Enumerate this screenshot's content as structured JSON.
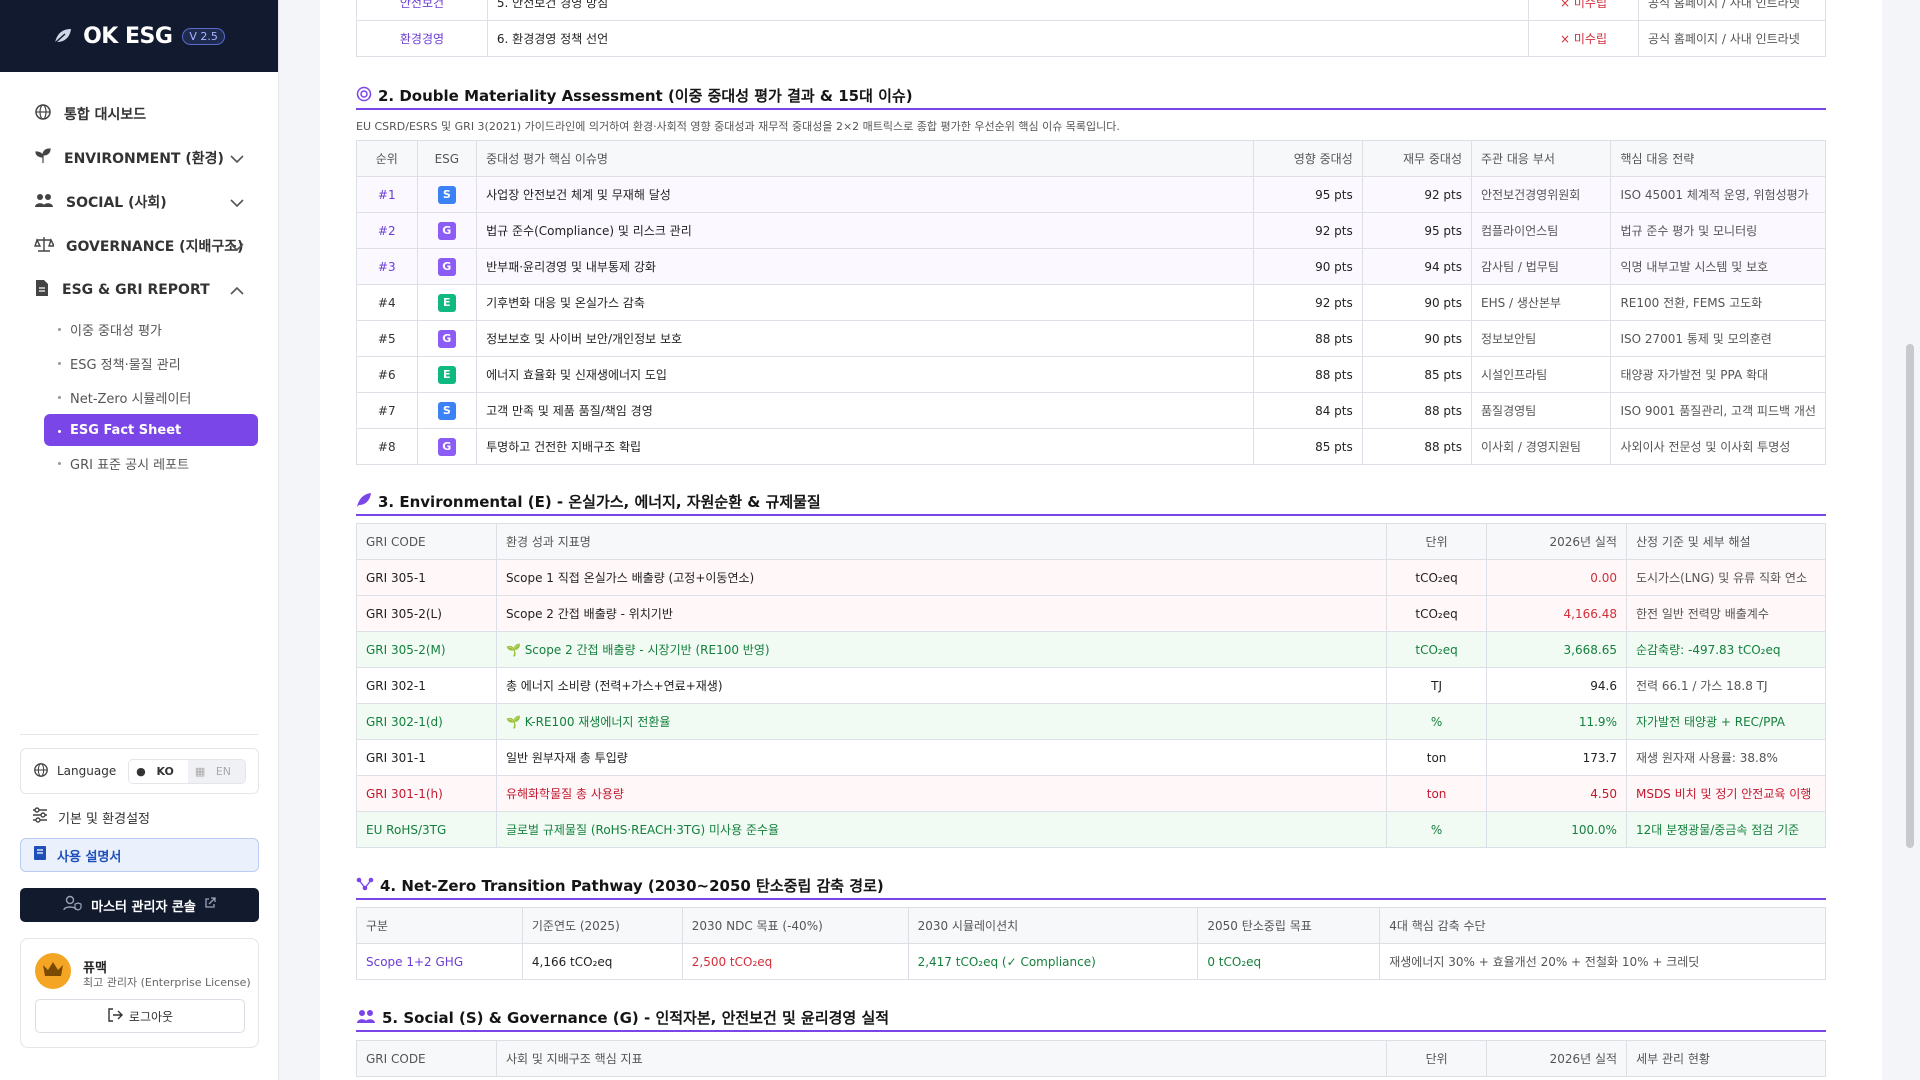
{
  "sidebar": {
    "logo_text": "OK ESG",
    "version": "V 2.5",
    "nav": [
      {
        "label": "통합 대시보드",
        "icon": "globe-icon"
      },
      {
        "label": "ENVIRONMENT (환경)",
        "icon": "leaf-icon"
      },
      {
        "label": "SOCIAL (사회)",
        "icon": "users-icon"
      },
      {
        "label": "GOVERNANCE (지배구조)",
        "icon": "scale-icon"
      },
      {
        "label": "ESG & GRI REPORT",
        "icon": "report-icon"
      }
    ],
    "sub": [
      "이중 중대성 평가",
      "ESG 정책·물질 관리",
      "Net-Zero 시뮬레이터",
      "ESG Fact Sheet",
      "GRI 표준 공시 레포트"
    ],
    "language_label": "Language",
    "lang_ko": "KO",
    "lang_en": "EN",
    "settings_label": "기본 및 환경설정",
    "manual_label": "사용 설명서",
    "console_label": "마스터 관리자 콘솔",
    "user_name": "퓨맥",
    "user_role": "최고 관리자 (Enterprise License)",
    "logout_label": "로그아웃"
  },
  "main": {
    "top_rows": [
      {
        "cat": "안전보건",
        "policy": "5. 안전보건 경영 방침",
        "status": "× 미수립",
        "channel": "공식 홈페이지 / 사내 인트라넷"
      },
      {
        "cat": "환경경영",
        "policy": "6. 환경경영 정책 선언",
        "status": "× 미수립",
        "channel": "공식 홈페이지 / 사내 인트라넷"
      }
    ],
    "s2": {
      "title": "2. Double Materiality Assessment (이중 중대성 평가 결과 & 15대 이슈)",
      "desc": "EU CSRD/ESRS 및 GRI 3(2021) 가이드라인에 의거하여 환경·사회적 영향 중대성과 재무적 중대성을 2×2 매트릭스로 종합 평가한 우선순위 핵심 이슈 목록입니다.",
      "headers": [
        "순위",
        "ESG",
        "중대성 평가 핵심 이슈명",
        "영향 중대성",
        "재무 중대성",
        "주관 대응 부서",
        "핵심 대응 전략"
      ],
      "rows": [
        {
          "rank": "#1",
          "esg": "S",
          "issue": "사업장 안전보건 체계 및 무재해 달성",
          "impact": "95 pts",
          "fin": "92 pts",
          "dept": "안전보건경영위원회",
          "strategy": "ISO 45001 체계적 운영, 위험성평가"
        },
        {
          "rank": "#2",
          "esg": "G",
          "issue": "법규 준수(Compliance) 및 리스크 관리",
          "impact": "92 pts",
          "fin": "95 pts",
          "dept": "컴플라이언스팀",
          "strategy": "법규 준수 평가 및 모니터링"
        },
        {
          "rank": "#3",
          "esg": "G",
          "issue": "반부패·윤리경영 및 내부통제 강화",
          "impact": "90 pts",
          "fin": "94 pts",
          "dept": "감사팀 / 법무팀",
          "strategy": "익명 내부고발 시스템 및 보호"
        },
        {
          "rank": "#4",
          "esg": "E",
          "issue": "기후변화 대응 및 온실가스 감축",
          "impact": "92 pts",
          "fin": "90 pts",
          "dept": "EHS / 생산본부",
          "strategy": "RE100 전환, FEMS 고도화"
        },
        {
          "rank": "#5",
          "esg": "G",
          "issue": "정보보호 및 사이버 보안/개인정보 보호",
          "impact": "88 pts",
          "fin": "90 pts",
          "dept": "정보보안팀",
          "strategy": "ISO 27001 통제 및 모의훈련"
        },
        {
          "rank": "#6",
          "esg": "E",
          "issue": "에너지 효율화 및 신재생에너지 도입",
          "impact": "88 pts",
          "fin": "85 pts",
          "dept": "시설인프라팀",
          "strategy": "태양광 자가발전 및 PPA 확대"
        },
        {
          "rank": "#7",
          "esg": "S",
          "issue": "고객 만족 및 제품 품질/책임 경영",
          "impact": "84 pts",
          "fin": "88 pts",
          "dept": "품질경영팀",
          "strategy": "ISO 9001 품질관리, 고객 피드백 개선"
        },
        {
          "rank": "#8",
          "esg": "G",
          "issue": "투명하고 건전한 지배구조 확립",
          "impact": "85 pts",
          "fin": "88 pts",
          "dept": "이사회 / 경영지원팀",
          "strategy": "사외이사 전문성 및 이사회 투명성"
        }
      ]
    },
    "s3": {
      "title": "3. Environmental (E) - 온실가스, 에너지, 자원순환 & 규제물질",
      "headers": [
        "GRI CODE",
        "환경 성과 지표명",
        "단위",
        "2026년 실적",
        "산정 기준 및 세부 해설"
      ],
      "rows": [
        {
          "code": "GRI 305-1",
          "name": "Scope 1 직접 온실가스 배출량 (고정+이동연소)",
          "unit": "tCO₂eq",
          "value": "0.00",
          "note": "도시가스(LNG) 및 유류 직화 연소",
          "style": "red"
        },
        {
          "code": "GRI 305-2(L)",
          "name": "Scope 2 간접 배출량 - 위치기반",
          "unit": "tCO₂eq",
          "value": "4,166.48",
          "note": "한전 일반 전력망 배출계수",
          "style": "red"
        },
        {
          "code": "GRI 305-2(M)",
          "name": "🌱 Scope 2 간접 배출량 - 시장기반 (RE100 반영)",
          "unit": "tCO₂eq",
          "value": "3,668.65",
          "note": "순감축량: -497.83 tCO₂eq",
          "style": "green"
        },
        {
          "code": "GRI 302-1",
          "name": "총 에너지 소비량 (전력+가스+연료+재생)",
          "unit": "TJ",
          "value": "94.6",
          "note": "전력 66.1 / 가스 18.8 TJ",
          "style": "plain"
        },
        {
          "code": "GRI 302-1(d)",
          "name": "🌱 K-RE100 재생에너지 전환율",
          "unit": "%",
          "value": "11.9%",
          "note": "자가발전 태양광 + REC/PPA",
          "style": "green"
        },
        {
          "code": "GRI 301-1",
          "name": "일반 원부자재 총 투입량",
          "unit": "ton",
          "value": "173.7",
          "note": "재생 원자재 사용률: 38.8%",
          "style": "plain"
        },
        {
          "code": "GRI 301-1(h)",
          "name": "유해화학물질 총 사용량",
          "unit": "ton",
          "value": "4.50",
          "note": "MSDS 비치 및 정기 안전교육 이행",
          "style": "redtext"
        },
        {
          "code": "EU RoHS/3TG",
          "name": "글로벌 규제물질 (RoHS·REACH·3TG) 미사용 준수율",
          "unit": "%",
          "value": "100.0%",
          "note": "12대 분쟁광물/중금속 점검 기준",
          "style": "green"
        }
      ]
    },
    "s4": {
      "title": "4. Net-Zero Transition Pathway (2030~2050 탄소중립 감축 경로)",
      "headers": [
        "구분",
        "기준연도 (2025)",
        "2030 NDC 목표 (-40%)",
        "2030 시뮬레이션치",
        "2050 탄소중립 목표",
        "4대 핵심 감축 수단"
      ],
      "row": {
        "label": "Scope 1+2 GHG",
        "base": "4,166 tCO₂eq",
        "ndc": "2,500 tCO₂eq",
        "sim": "2,417 tCO₂eq (✓ Compliance)",
        "nz": "0 tCO₂eq",
        "means": "재생에너지 30% + 효율개선 20% + 전철화 10% + 크레딧"
      }
    },
    "s5": {
      "title": "5. Social (S) & Governance (G) - 인적자본, 안전보건 및 윤리경영 실적",
      "headers": [
        "GRI CODE",
        "사회 및 지배구조 핵심 지표",
        "단위",
        "2026년 실적",
        "세부 관리 현황"
      ]
    }
  }
}
